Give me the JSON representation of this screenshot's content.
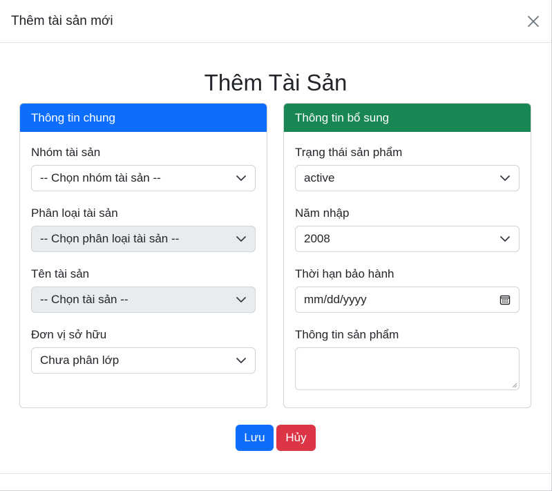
{
  "modal": {
    "title": "Thêm tài sản mới",
    "page_title": "Thêm Tài Sản"
  },
  "general_card": {
    "header": "Thông tin chung",
    "header_color": "#0d6efd",
    "fields": [
      {
        "label": "Nhóm tài sản",
        "value": "-- Chọn nhóm tài sản --",
        "disabled": false
      },
      {
        "label": "Phân loại tài sản",
        "value": "-- Chọn phân loại tài sản --",
        "disabled": true
      },
      {
        "label": "Tên tài sản",
        "value": "-- Chọn tài sản --",
        "disabled": true
      },
      {
        "label": "Đơn vị sở hữu",
        "value": "Chưa phân lớp",
        "disabled": false
      }
    ]
  },
  "extra_card": {
    "header": "Thông tin bổ sung",
    "header_color": "#198754",
    "status_label": "Trạng thái sản phẩm",
    "status_value": "active",
    "year_label": "Năm nhập",
    "year_value": "2008",
    "warranty_label": "Thời hạn bảo hành",
    "warranty_placeholder": "mm/dd/yyyy",
    "info_label": "Thông tin sản phẩm",
    "info_value": ""
  },
  "actions": {
    "save_label": "Lưu",
    "save_color": "#0d6efd",
    "cancel_label": "Hủy",
    "cancel_color": "#dc3545"
  },
  "icons": {
    "close": "close-icon",
    "dropdown": "chevron-down-icon",
    "calendar": "calendar-icon"
  }
}
